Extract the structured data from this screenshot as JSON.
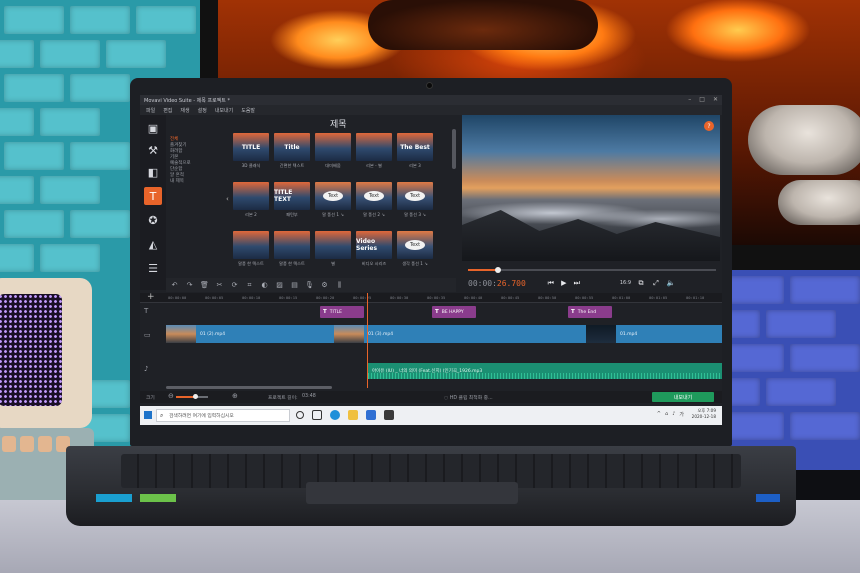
{
  "app": {
    "window_title": "Movavi Video Suite - 제목 프로젝트 *",
    "menu": [
      "파일",
      "편집",
      "재생",
      "설정",
      "내보내기",
      "도움말"
    ],
    "panel_title": "제목",
    "categories": [
      "전체",
      "즐겨찾기",
      "화려함",
      "기본",
      "예술적으로",
      "단순함",
      "알 흔적",
      "내 제목"
    ],
    "tiles": [
      {
        "label": "3D 클래식",
        "text": "TITLE",
        "style": "grad"
      },
      {
        "label": "간편한 텍스트",
        "text": "Title",
        "style": "grad"
      },
      {
        "label": "대미배움",
        "text": "",
        "style": "grad"
      },
      {
        "label": "리본 - 별",
        "text": "",
        "style": "grad"
      },
      {
        "label": "리본 3",
        "text": "The Best",
        "style": "grad"
      },
      {
        "label": "리본 2",
        "text": "",
        "style": "grad"
      },
      {
        "label": "패턴부",
        "text": "TITLE TEXT",
        "style": "grad"
      },
      {
        "label": "말 풍선 1 ↘",
        "text": "Text",
        "style": "bubble"
      },
      {
        "label": "말 풍선 2 ↘",
        "text": "Text",
        "style": "bubble"
      },
      {
        "label": "말 풍선 3 ↘",
        "text": "Text",
        "style": "bubble"
      },
      {
        "label": "말풍 한 텍스트",
        "text": "",
        "style": "grad"
      },
      {
        "label": "말풍 한 텍스트",
        "text": "",
        "style": "grad"
      },
      {
        "label": "별",
        "text": "",
        "style": "grad"
      },
      {
        "label": "비디오 시리즈",
        "text": "Video Series",
        "style": "grad"
      },
      {
        "label": "생각 풍선 1 ↘",
        "text": "Text",
        "style": "bubble"
      }
    ],
    "help_glyph": "?",
    "timecode_gray": "00:00:",
    "timecode_accent": "26.700",
    "aspect_ratio": "16:9",
    "preview_progress": 0.12,
    "ruler_ticks": [
      "00:00:00",
      "00:00:05",
      "00:00:10",
      "00:00:15",
      "00:00:20",
      "00:00:25",
      "00:00:30",
      "00:00:35",
      "00:00:40",
      "00:00:45",
      "00:00:50",
      "00:00:55",
      "00:01:00",
      "00:01:05",
      "00:01:10"
    ],
    "title_clips": [
      {
        "icon": "T",
        "name": "TITLE"
      },
      {
        "icon": "T",
        "name": "BE HAPPY"
      },
      {
        "icon": "T",
        "name": "The End"
      }
    ],
    "video_clips": [
      "01 (2).mp4",
      "01 (3).mp4",
      "01.mp4"
    ],
    "audio_clip": "아이유 (IU) _ 너의 의미 (Feat.신지) (인기곡_1926.mp3",
    "status": {
      "zoom_label": "크기",
      "zoom_value": 0.62,
      "project_length_label": "프로젝트 길이:",
      "project_length": "03:48",
      "hd_clip": "HD 클립 최적화 중...",
      "export_button": "내보내기"
    },
    "taskbar": {
      "search_placeholder": "검색하려면 여기에 입력하십시오",
      "time": "오후 7:09",
      "date": "2020-12-18"
    }
  },
  "colors": {
    "accent": "#e8642a",
    "video_track": "#2f80b7",
    "audio_track": "#1b8f72",
    "title_clip": "#8a3c8c",
    "export": "#1f9a5c"
  }
}
